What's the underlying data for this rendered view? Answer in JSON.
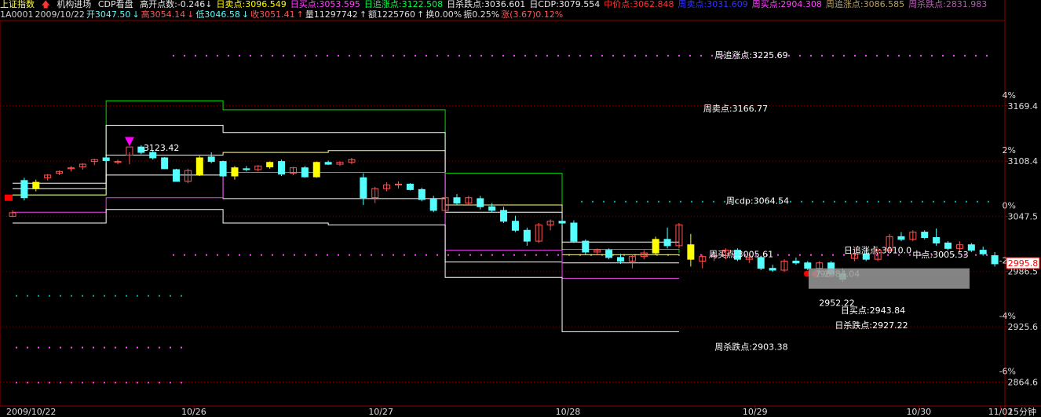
{
  "header": {
    "index_name": "上证指数",
    "menu_items": [
      "机构进场",
      "CDP看盘"
    ],
    "row1": [
      {
        "label": "高开点数:",
        "value": "-0.246",
        "arrow": "↓",
        "color": "#e8e8e8"
      },
      {
        "label": "日卖点:",
        "value": "3096.549",
        "arrow": "",
        "color": "#ffff00"
      },
      {
        "label": "日买点:",
        "value": "3053.595",
        "arrow": "",
        "color": "#ff44ff"
      },
      {
        "label": "日追涨点:",
        "value": "3122.508",
        "arrow": "",
        "color": "#00ff44"
      },
      {
        "label": "日杀跌点:",
        "value": "3036.601",
        "arrow": "",
        "color": "#e8e8e8"
      },
      {
        "label": "日CDP:",
        "value": "3079.554",
        "arrow": "",
        "color": "#e8e8e8"
      },
      {
        "label": "中价点:",
        "value": "3062.848",
        "arrow": "",
        "color": "#ff3333"
      },
      {
        "label": "周卖点:",
        "value": "3031.609",
        "arrow": "",
        "color": "#3333ff"
      },
      {
        "label": "周买点:",
        "value": "2904.308",
        "arrow": "",
        "color": "#ff44ff"
      },
      {
        "label": "周追涨点:",
        "value": "3086.585",
        "arrow": "",
        "color": "#b8a060"
      },
      {
        "label": "周杀跌点:",
        "value": "2831.983",
        "arrow": "",
        "color": "#b060b0"
      }
    ],
    "row2": [
      {
        "text": "1A0001",
        "color": "#cfcfcf"
      },
      {
        "text": "2009/10/22",
        "color": "#cfcfcf"
      },
      {
        "text": "开3047.50",
        "color": "#55ffff"
      },
      {
        "text": "↓",
        "color": "#55ffff"
      },
      {
        "text": "高3054.14",
        "color": "#ff5555"
      },
      {
        "text": "↓",
        "color": "#ff5555"
      },
      {
        "text": "低3046.58",
        "color": "#55ffff"
      },
      {
        "text": "↓",
        "color": "#55ffff"
      },
      {
        "text": "收3051.41",
        "color": "#ff5555"
      },
      {
        "text": "↑",
        "color": "#ff5555"
      },
      {
        "text": "量11297742",
        "color": "#dddddd"
      },
      {
        "text": "↑",
        "color": "#dddddd"
      },
      {
        "text": "额1225760",
        "color": "#dddddd"
      },
      {
        "text": "↑",
        "color": "#dddddd"
      },
      {
        "text": "换0.00%",
        "color": "#dddddd"
      },
      {
        "text": "振0.25%",
        "color": "#dddddd"
      },
      {
        "text": "涨(3.67)0.12%",
        "color": "#ff5555"
      }
    ]
  },
  "colors": {
    "up": "#ff5555",
    "down": "#55ffff",
    "highlight": "#ffff00",
    "grid": "#8a0000",
    "green_line": "#00dd00",
    "white_line": "#ffffff",
    "yellow_line": "#ffff99",
    "magenta_line": "#ee44ee"
  },
  "chart_data": {
    "type": "candlestick",
    "title": "上证指数 15分钟",
    "period": "15分钟",
    "date_labels": [
      "2009/10/22",
      "10/26",
      "10/27",
      "10/28",
      "10/29",
      "10/30",
      "11/02"
    ],
    "y_ticks": [
      3169.4,
      3108.4,
      3047.5,
      2986.5,
      2925.6,
      2864.6
    ],
    "pct_ticks": [
      "4%",
      "2%",
      "0%",
      "-2%",
      "-4%",
      "-6%"
    ],
    "current_price_label": "2995.8",
    "ylim": [
      2838,
      3262
    ],
    "week_labels": [
      {
        "text": "周追涨点:3225.69",
        "value": 3225.69
      },
      {
        "text": "周卖点:3166.77",
        "value": 3166.77
      },
      {
        "text": "周cdp:3064.54",
        "value": 3064.54
      },
      {
        "text": "周买点:3005.61",
        "value": 3005.61
      },
      {
        "text": "周杀跌点:2903.38",
        "value": 2903.38
      }
    ],
    "day_labels": [
      {
        "text": "日追涨点:3010.0",
        "value": 3010.0
      },
      {
        "text": "中点:3005.53",
        "value": 3005.53
      },
      {
        "text": "296",
        "value": 2984.04
      },
      {
        "text": "7-2984.04",
        "value": 2984.04
      },
      {
        "text": "2952.22",
        "value": 2952.22
      },
      {
        "text": "日买点:2943.84",
        "value": 2943.84
      },
      {
        "text": "日杀跌点:2927.22",
        "value": 2927.22
      }
    ],
    "peak_label": {
      "text": "3123.42",
      "value": 3123.42
    },
    "step_lines": [
      {
        "name": "green",
        "color": "#00dd00",
        "segments": [
          [
            0,
            3071
          ],
          [
            8,
            3071
          ],
          [
            8,
            3175
          ],
          [
            18,
            3175
          ],
          [
            18,
            3165
          ],
          [
            27,
            3165
          ],
          [
            27,
            3165
          ],
          [
            37,
            3165
          ],
          [
            37,
            3095
          ],
          [
            47,
            3095
          ],
          [
            47,
            3011
          ],
          [
            57,
            3011
          ],
          [
            57,
            3007
          ]
        ]
      },
      {
        "name": "yellow",
        "color": "#ffff99",
        "segments": [
          [
            0,
            3071
          ],
          [
            8,
            3071
          ],
          [
            8,
            3115
          ],
          [
            18,
            3115
          ],
          [
            18,
            3118
          ],
          [
            27,
            3118
          ],
          [
            27,
            3120
          ],
          [
            37,
            3120
          ],
          [
            37,
            3060
          ],
          [
            47,
            3060
          ],
          [
            47,
            3005
          ],
          [
            57,
            3005
          ]
        ]
      },
      {
        "name": "white-upper",
        "color": "#ffffff",
        "segments": [
          [
            0,
            3084
          ],
          [
            8,
            3084
          ],
          [
            8,
            3148
          ],
          [
            18,
            3148
          ],
          [
            18,
            3140
          ],
          [
            27,
            3140
          ],
          [
            27,
            3140
          ],
          [
            37,
            3140
          ],
          [
            37,
            3052
          ],
          [
            47,
            3052
          ],
          [
            47,
            3019
          ],
          [
            57,
            3019
          ]
        ]
      },
      {
        "name": "white-mid",
        "color": "#ffffff",
        "segments": [
          [
            0,
            3078
          ],
          [
            8,
            3078
          ],
          [
            8,
            3093
          ],
          [
            18,
            3093
          ],
          [
            18,
            3067
          ],
          [
            27,
            3067
          ],
          [
            27,
            3067
          ],
          [
            37,
            3067
          ],
          [
            37,
            2997
          ],
          [
            47,
            2997
          ],
          [
            47,
            2996
          ],
          [
            57,
            2996
          ]
        ]
      },
      {
        "name": "magenta",
        "color": "#ee44ee",
        "segments": [
          [
            0,
            3052
          ],
          [
            8,
            3052
          ],
          [
            8,
            3068
          ],
          [
            18,
            3068
          ],
          [
            18,
            3096
          ],
          [
            27,
            3096
          ],
          [
            27,
            3096
          ],
          [
            37,
            3096
          ],
          [
            37,
            3010
          ],
          [
            47,
            3010
          ],
          [
            47,
            2979
          ],
          [
            57,
            2979
          ]
        ]
      },
      {
        "name": "white-lower",
        "color": "#ffffff",
        "segments": [
          [
            0,
            3040
          ],
          [
            8,
            3040
          ],
          [
            8,
            3055
          ],
          [
            18,
            3055
          ],
          [
            18,
            3040
          ],
          [
            27,
            3040
          ],
          [
            27,
            3038
          ],
          [
            37,
            3038
          ],
          [
            37,
            2980
          ],
          [
            47,
            2980
          ],
          [
            47,
            2920
          ],
          [
            57,
            2920
          ]
        ]
      }
    ],
    "dot_lines": [
      {
        "color": "#ff44ff",
        "value": 3225.69,
        "from": 10,
        "to": 56
      },
      {
        "color": "#00aaaa",
        "value": 3064.54,
        "from": 36,
        "to": 56
      },
      {
        "color": "#ff44ff",
        "value": 3005.61,
        "from": 10,
        "to": 56
      },
      {
        "color": "#00aaaa",
        "value": 2960.5,
        "from": 0,
        "to": 9
      },
      {
        "color": "#ff44ff",
        "value": 2903.38,
        "from": 0,
        "to": 9
      },
      {
        "color": "#ff44ff",
        "value": 2864.6,
        "from": 0,
        "to": 9
      }
    ],
    "candles": [
      [
        3047.5,
        3054.1,
        3046.6,
        3051.4
      ],
      [
        3087,
        3090,
        3065,
        3068
      ],
      [
        3078,
        3088,
        3075,
        3085
      ],
      [
        3090,
        3094,
        3087,
        3093
      ],
      [
        3095,
        3098,
        3093,
        3097
      ],
      [
        3100,
        3103,
        3097,
        3101
      ],
      [
        3102,
        3106,
        3099,
        3105
      ],
      [
        3108,
        3111,
        3104,
        3110
      ],
      [
        3112,
        3114,
        3106,
        3109
      ],
      [
        3107,
        3110,
        3105,
        3108
      ],
      [
        3115,
        3118,
        3105,
        3124
      ],
      [
        3124,
        3126,
        3116,
        3118
      ],
      [
        3118,
        3120,
        3110,
        3112
      ],
      [
        3112,
        3113,
        3100,
        3100
      ],
      [
        3099,
        3100,
        3086,
        3086
      ],
      [
        3086,
        3100,
        3084,
        3098
      ],
      [
        3093,
        3114,
        3092,
        3112
      ],
      [
        3113,
        3118,
        3106,
        3108
      ],
      [
        3108,
        3109,
        3091,
        3092
      ],
      [
        3092,
        3103,
        3088,
        3101
      ],
      [
        3100,
        3103,
        3097,
        3099
      ],
      [
        3099,
        3104,
        3097,
        3103
      ],
      [
        3102,
        3108,
        3100,
        3107
      ],
      [
        3108,
        3110,
        3092,
        3094
      ],
      [
        3095,
        3102,
        3093,
        3101
      ],
      [
        3101,
        3103,
        3090,
        3091
      ],
      [
        3091,
        3108,
        3090,
        3107
      ],
      [
        3107,
        3109,
        3104,
        3105
      ],
      [
        3105,
        3108,
        3103,
        3107
      ],
      [
        3107,
        3112,
        3105,
        3110
      ],
      [
        3090,
        3095,
        3060,
        3068
      ],
      [
        3068,
        3080,
        3062,
        3078
      ],
      [
        3078,
        3085,
        3075,
        3082
      ],
      [
        3082,
        3086,
        3078,
        3083
      ],
      [
        3083,
        3084,
        3076,
        3077
      ],
      [
        3077,
        3079,
        3064,
        3066
      ],
      [
        3066,
        3070,
        3052,
        3054
      ],
      [
        3054,
        3070,
        3052,
        3068
      ],
      [
        3068,
        3072,
        3060,
        3062
      ],
      [
        3062,
        3070,
        3060,
        3068
      ],
      [
        3067,
        3070,
        3055,
        3058
      ],
      [
        3058,
        3062,
        3052,
        3054
      ],
      [
        3054,
        3058,
        3040,
        3042
      ],
      [
        3042,
        3048,
        3030,
        3032
      ],
      [
        3032,
        3035,
        3015,
        3020
      ],
      [
        3020,
        3040,
        3018,
        3038
      ],
      [
        3038,
        3044,
        3032,
        3042
      ],
      [
        3042,
        3045,
        3038,
        3040
      ],
      [
        3040,
        3043,
        3018,
        3020
      ],
      [
        3020,
        3022,
        3005,
        3008
      ],
      [
        3008,
        3012,
        3005,
        3010
      ],
      [
        3010,
        3012,
        3000,
        3002
      ],
      [
        3002,
        3006,
        2995,
        2998
      ],
      [
        2998,
        3005,
        2990,
        3003
      ],
      [
        3003,
        3010,
        3000,
        3007
      ],
      [
        3007,
        3025,
        3005,
        3022
      ],
      [
        3022,
        3035,
        3012,
        3015
      ],
      [
        3015,
        3040,
        3012,
        3038
      ],
      [
        3016,
        3028,
        2992,
        3000
      ],
      [
        2998,
        3005,
        2990,
        3003
      ],
      [
        3003,
        3008,
        2998,
        3004
      ],
      [
        3004,
        3012,
        3000,
        3010
      ],
      [
        3010,
        3012,
        2998,
        3000
      ],
      [
        3000,
        3006,
        2996,
        3002
      ],
      [
        3002,
        3004,
        2988,
        2990
      ],
      [
        2990,
        2994,
        2986,
        2988
      ],
      [
        2988,
        3000,
        2986,
        2998
      ],
      [
        2998,
        3002,
        2994,
        2996
      ],
      [
        2996,
        2998,
        2988,
        2990
      ],
      [
        2990,
        2998,
        2986,
        2996
      ],
      [
        2996,
        2998,
        2982,
        2984
      ],
      [
        2984,
        2990,
        2975,
        2978
      ],
      [
        3001,
        3012,
        2998,
        3006
      ],
      [
        3006,
        3010,
        2998,
        3000
      ],
      [
        3000,
        3012,
        2998,
        3010
      ],
      [
        3010,
        3028,
        3008,
        3025
      ],
      [
        3025,
        3030,
        3020,
        3022
      ],
      [
        3022,
        3032,
        3020,
        3030
      ],
      [
        3030,
        3032,
        3022,
        3024
      ],
      [
        3024,
        3034,
        3015,
        3018
      ],
      [
        3018,
        3020,
        3010,
        3012
      ],
      [
        3012,
        3020,
        3008,
        3016
      ],
      [
        3016,
        3018,
        3008,
        3010
      ],
      [
        3010,
        3014,
        3004,
        3006
      ],
      [
        3004,
        3008,
        2992,
        2995
      ]
    ],
    "highlights": [
      2,
      16,
      19,
      22,
      26,
      55,
      58
    ]
  },
  "footer": {
    "period_label": "15分钟"
  }
}
